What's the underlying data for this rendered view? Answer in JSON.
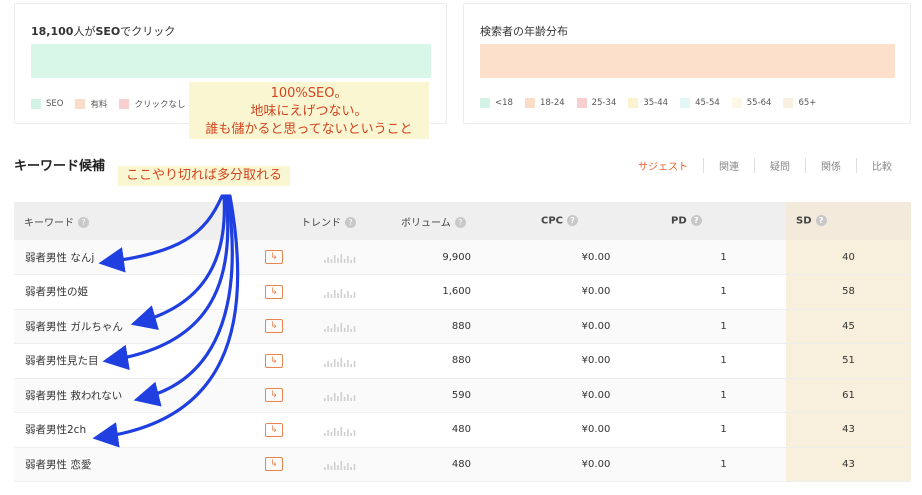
{
  "cards": {
    "clicks": {
      "title_bold1": "18,100",
      "title_mid": "人が",
      "title_bold2": "SEO",
      "title_rest": "でクリック",
      "bar_color": "#d9f7e8",
      "legend": [
        {
          "label": "SEO",
          "color": "#d3f3e7"
        },
        {
          "label": "有料",
          "color": "#fbdcc9"
        },
        {
          "label": "クリックなし",
          "color": "#f7cfd0"
        }
      ]
    },
    "age": {
      "title": "検索者の年齢分布",
      "bar_color": "#fce0cc",
      "legend": [
        {
          "label": "<18",
          "color": "#d3f3e7"
        },
        {
          "label": "18-24",
          "color": "#fbdcc9"
        },
        {
          "label": "25-34",
          "color": "#f7cfd0"
        },
        {
          "label": "35-44",
          "color": "#fbf3cf"
        },
        {
          "label": "45-54",
          "color": "#e3f7f6"
        },
        {
          "label": "55-64",
          "color": "#fdf8e6"
        },
        {
          "label": "65+",
          "color": "#f8f0e0"
        }
      ]
    }
  },
  "annotation": {
    "lines": [
      "100%SEO。",
      "地味にえげつない。",
      "誰も儲かると思ってないということ"
    ],
    "callout": "ここやり切れば多分取れる"
  },
  "section_title": "キーワード候補",
  "tabs": [
    {
      "label": "サジェスト",
      "active": true
    },
    {
      "label": "関連",
      "active": false
    },
    {
      "label": "疑問",
      "active": false
    },
    {
      "label": "関係",
      "active": false
    },
    {
      "label": "比較",
      "active": false
    }
  ],
  "table": {
    "headers": {
      "keyword": "キーワード",
      "trend": "トレンド",
      "volume": "ボリューム",
      "cpc": "CPC",
      "pd": "PD",
      "sd": "SD"
    },
    "rows": [
      {
        "keyword": "弱者男性 なんj",
        "volume": "9,900",
        "cpc": "¥0.00",
        "pd": "1",
        "sd": "40"
      },
      {
        "keyword": "弱者男性の姫",
        "volume": "1,600",
        "cpc": "¥0.00",
        "pd": "1",
        "sd": "58"
      },
      {
        "keyword": "弱者男性 ガルちゃん",
        "volume": "880",
        "cpc": "¥0.00",
        "pd": "1",
        "sd": "45"
      },
      {
        "keyword": "弱者男性見た目",
        "volume": "880",
        "cpc": "¥0.00",
        "pd": "1",
        "sd": "51"
      },
      {
        "keyword": "弱者男性 救われない",
        "volume": "590",
        "cpc": "¥0.00",
        "pd": "1",
        "sd": "61"
      },
      {
        "keyword": "弱者男性2ch",
        "volume": "480",
        "cpc": "¥0.00",
        "pd": "1",
        "sd": "43"
      },
      {
        "keyword": "弱者男性 恋愛",
        "volume": "480",
        "cpc": "¥0.00",
        "pd": "1",
        "sd": "43"
      }
    ],
    "row_icon": "external-link-icon",
    "trend_icon": "sparkline-icon"
  },
  "colors": {
    "accent": "#e4622d",
    "annotation_text": "#d1441f",
    "annotation_bg": "#fbf6d2",
    "arrow": "#1f3fe0",
    "sd_column": "#f8efdd"
  }
}
